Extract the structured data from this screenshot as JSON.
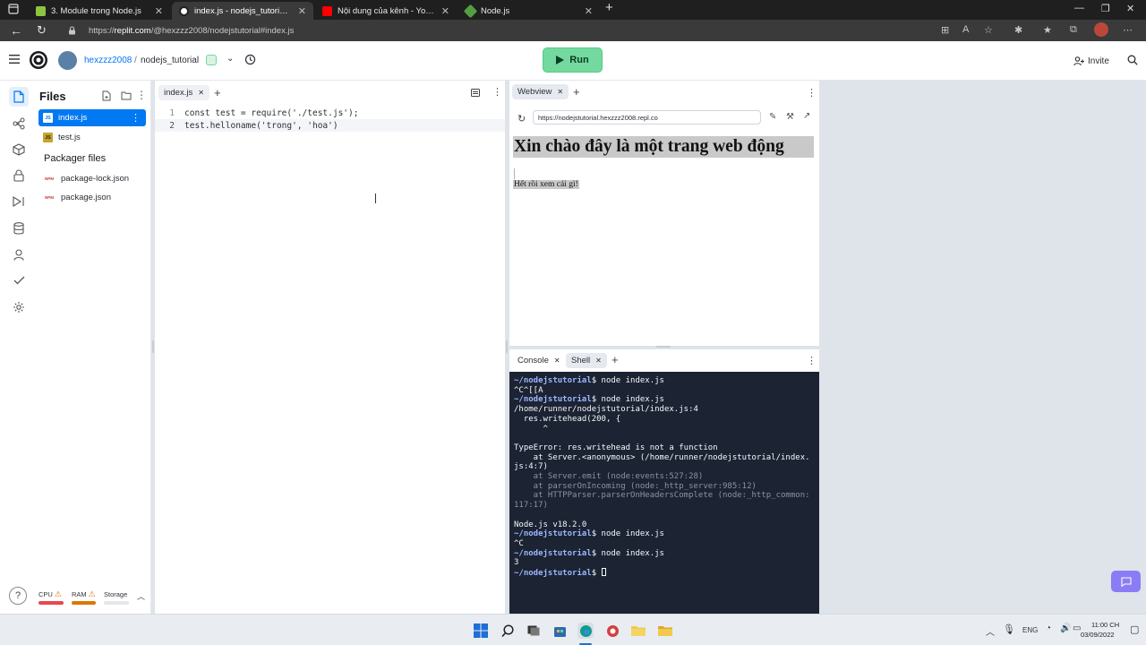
{
  "browser": {
    "tabs": [
      {
        "title": "3. Module trong Node.js",
        "color": "#8dc53f"
      },
      {
        "title": "index.js - nodejs_tutorial - Replit",
        "color": "#ffffff"
      },
      {
        "title": "Nội dung của kênh - YouTube St",
        "color": "#ff0000"
      },
      {
        "title": "Node.js",
        "color": "#539e43"
      }
    ],
    "url_prefix": "https://",
    "url_host": "replit.com",
    "url_path": "/@hexzzz2008/nodejstutorial#index.js"
  },
  "header": {
    "username": "hexzzz2008",
    "separator": "/",
    "repl_name": "nodejs_tutorial",
    "run_label": "Run",
    "invite_label": "Invite"
  },
  "files": {
    "title": "Files",
    "items": [
      {
        "name": "index.js",
        "badge": "JS"
      },
      {
        "name": "test.js",
        "badge": "JS"
      }
    ],
    "packager_title": "Packager files",
    "packager_items": [
      {
        "name": "package-lock.json",
        "badge": "NPM"
      },
      {
        "name": "package.json",
        "badge": "NPM"
      }
    ],
    "resources": {
      "cpu": "CPU",
      "ram": "RAM",
      "storage": "Storage"
    },
    "help": "?"
  },
  "editor": {
    "tab": "index.js",
    "lines": [
      {
        "num": "1",
        "text": "const test = require('./test.js');"
      },
      {
        "num": "2",
        "text": "test.helloname('trong', 'hoa')"
      }
    ]
  },
  "webview": {
    "tab": "Webview",
    "url": "https://nodejstutorial.hexzzz2008.repl.co",
    "heading": "Xin chào đây là một trang web động",
    "body": "Hết rồi xem cái gì!"
  },
  "console": {
    "tabs": [
      "Console",
      "Shell"
    ],
    "terminal": [
      {
        "p": "~/nodejstutorial",
        "t": "$ node index.js"
      },
      {
        "t": "^C^[[A"
      },
      {
        "p": "~/nodejstutorial",
        "t": "$ node index.js"
      },
      {
        "t": "/home/runner/nodejstutorial/index.js:4"
      },
      {
        "t": "  res.writehead(200, {"
      },
      {
        "t": "      ^"
      },
      {
        "t": ""
      },
      {
        "t": "TypeError: res.writehead is not a function"
      },
      {
        "t": "    at Server.<anonymous> (/home/runner/nodejstutorial/index."
      },
      {
        "t": "js:4:7)"
      },
      {
        "t": "    at Server.emit (node:events:527:28)",
        "dim": true
      },
      {
        "t": "    at parserOnIncoming (node:_http_server:985:12)",
        "dim": true
      },
      {
        "t": "    at HTTPParser.parserOnHeadersComplete (node:_http_common:",
        "dim": true
      },
      {
        "t": "117:17)",
        "dim": true
      },
      {
        "t": ""
      },
      {
        "t": "Node.js v18.2.0"
      },
      {
        "p": "~/nodejstutorial",
        "t": "$ node index.js"
      },
      {
        "t": "^C"
      },
      {
        "p": "~/nodejstutorial",
        "t": "$ node index.js"
      },
      {
        "t": "3"
      },
      {
        "p": "~/nodejstutorial",
        "t": "$ ",
        "cursor": true
      }
    ]
  },
  "taskbar": {
    "lang": "ENG",
    "time": "11:00 CH",
    "date": "03/09/2022"
  },
  "colors": {
    "accent": "#0079f2",
    "run": "#73d99f",
    "terminal_bg": "#1c2333"
  }
}
